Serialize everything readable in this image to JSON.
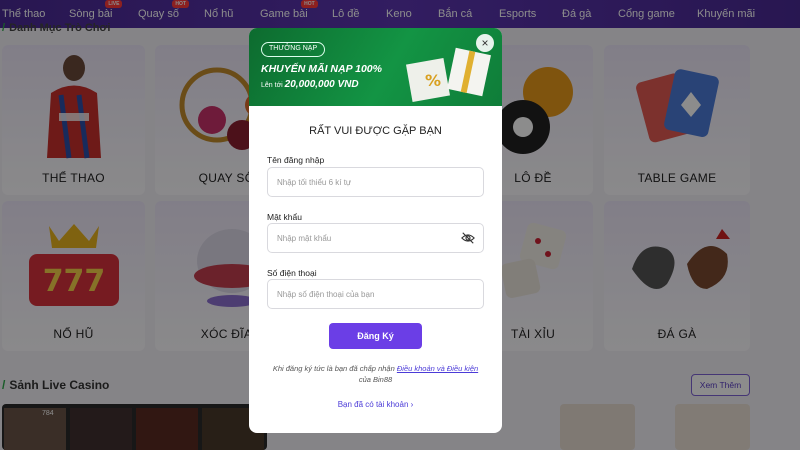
{
  "nav": {
    "items": [
      {
        "label": "Thể thao",
        "badge": ""
      },
      {
        "label": "Sòng bài",
        "badge": "LIVE"
      },
      {
        "label": "Quay số",
        "badge": "HOT"
      },
      {
        "label": "Nổ hũ",
        "badge": ""
      },
      {
        "label": "Game bài",
        "badge": "HOT"
      },
      {
        "label": "Lô đề",
        "badge": ""
      },
      {
        "label": "Keno",
        "badge": ""
      },
      {
        "label": "Bắn cá",
        "badge": ""
      },
      {
        "label": "Esports",
        "badge": ""
      },
      {
        "label": "Đá gà",
        "badge": ""
      },
      {
        "label": "Cổng game",
        "badge": ""
      },
      {
        "label": "Khuyến mãi",
        "badge": ""
      }
    ]
  },
  "sections": {
    "games_title": "Danh Mục Trò Chơi",
    "casino_title": "Sảnh Live Casino",
    "see_more": "Xem Thêm"
  },
  "tiles": [
    "THỂ THAO",
    "QUAY SỐ",
    "LÔ ĐỀ",
    "TABLE GAME",
    "NỔ HŨ",
    "XÓC ĐĨA",
    "TÀI XỈU",
    "ĐÁ GÀ"
  ],
  "modal": {
    "promo_tag": "THƯỞNG NẠP",
    "promo_title": "KHUYẾN MÃI NẠP 100%",
    "promo_sub_prefix": "Lên tới",
    "promo_amount": "20,000,000 VND",
    "heading": "RẤT VUI ĐƯỢC GẶP BẠN",
    "username_label": "Tên đăng nhập",
    "username_placeholder": "Nhập tối thiểu 6 kí tự",
    "password_label": "Mật khẩu",
    "password_placeholder": "Nhập mật khẩu",
    "phone_label": "Số điện thoại",
    "phone_placeholder": "Nhập số điện thoại của bạn",
    "submit_label": "Đăng Ký",
    "terms_prefix": "Khi đăng ký tức là bạn đã chấp nhận",
    "terms_link": "Điều khoản và Điều kiện",
    "terms_suffix": "của Bin88",
    "login_link": "Bạn đã có tài khoản",
    "close_glyph": "×"
  },
  "casino": {
    "viewer_count": "784"
  },
  "colors": {
    "nav_bg": "#5b35b0",
    "banner_green": "#139444",
    "submit_purple": "#6b3ee6",
    "link_blue": "#4b3bd8"
  }
}
